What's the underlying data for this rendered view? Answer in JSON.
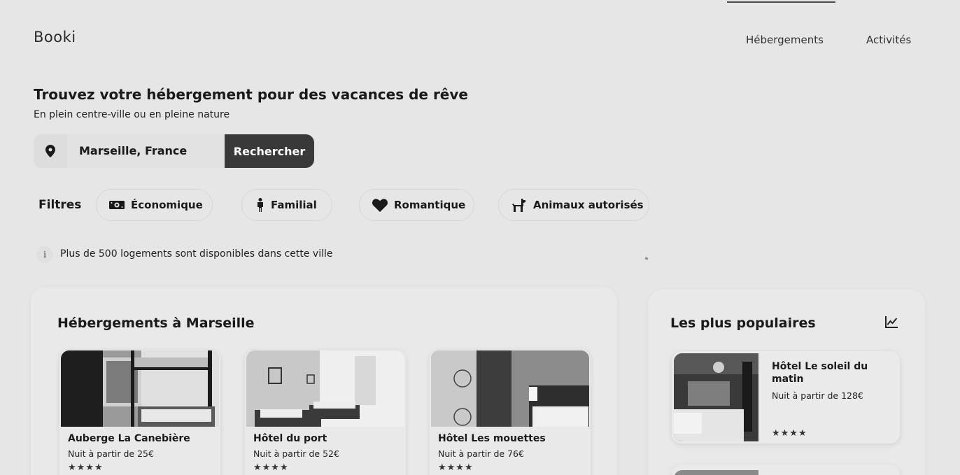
{
  "header": {
    "logo": "Booki",
    "nav": [
      "Hébergements",
      "Activités"
    ]
  },
  "hero": {
    "title": "Trouvez votre hébergement pour des vacances de rêve",
    "subtitle": "En plein centre-ville ou en pleine nature"
  },
  "search": {
    "value": "Marseille, France",
    "button_label": "Rechercher",
    "icon": "location-pin-icon"
  },
  "filters": {
    "label": "Filtres",
    "items": [
      {
        "label": "Économique",
        "icon": "money-icon"
      },
      {
        "label": "Familial",
        "icon": "person-icon"
      },
      {
        "label": "Romantique",
        "icon": "heart-icon"
      },
      {
        "label": "Animaux autorisés",
        "icon": "dog-icon"
      }
    ]
  },
  "info": {
    "icon": "info-icon",
    "text": "Plus de 500 logements sont disponibles dans cette ville"
  },
  "listings": {
    "title": "Hébergements à Marseille",
    "cards": [
      {
        "name": "Auberge La Canebière",
        "price": "Nuit à partir de 25€",
        "stars": "★★★★"
      },
      {
        "name": "Hôtel du port",
        "price": "Nuit à partir de 52€",
        "stars": "★★★★"
      },
      {
        "name": "Hôtel Les mouettes",
        "price": "Nuit à partir de 76€",
        "stars": "★★★★"
      }
    ]
  },
  "popular": {
    "title": "Les plus populaires",
    "icon": "trend-chart-icon",
    "items": [
      {
        "name": "Hôtel Le soleil du matin",
        "price": "Nuit à partir de 128€",
        "stars": "★★★★"
      }
    ]
  }
}
